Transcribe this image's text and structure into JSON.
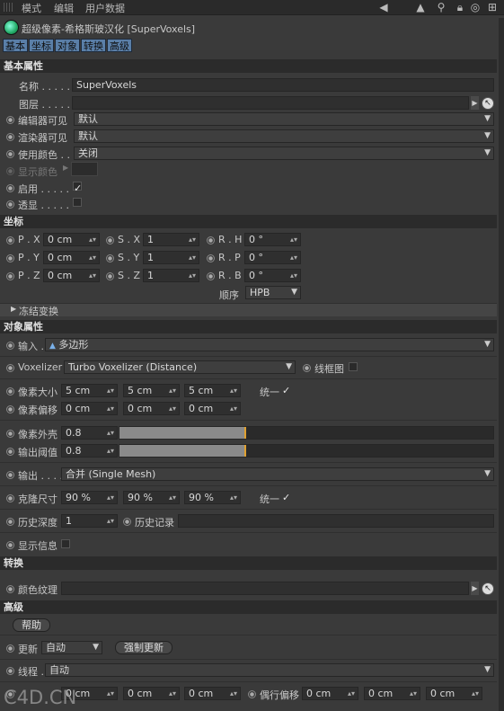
{
  "menubar": {
    "items": [
      "模式",
      "编辑",
      "用户数据"
    ]
  },
  "object": {
    "title": "超级像素-希格斯玻汉化 [SuperVoxels]"
  },
  "tabs": [
    "基本",
    "坐标",
    "对象",
    "转换",
    "高级"
  ],
  "basic": {
    "heading": "基本属性",
    "name_label": "名称 . . . . .",
    "name_value": "SuperVoxels",
    "layer_label": "图层 . . . . .",
    "editor_visible_label": "编辑器可见",
    "editor_visible_value": "默认",
    "render_visible_label": "渲染器可见",
    "render_visible_value": "默认",
    "use_color_label": "使用颜色 . .",
    "use_color_value": "关闭",
    "display_color_label": "显示颜色",
    "enable_label": "启用 . . . . .",
    "enable_checked": true,
    "xray_label": "透显 . . . . .",
    "xray_checked": false
  },
  "coord": {
    "heading": "坐标",
    "rows": [
      {
        "p_label": "P . X",
        "p_value": "0 cm",
        "s_label": "S . X",
        "s_value": "1",
        "r_label": "R . H",
        "r_value": "0 °"
      },
      {
        "p_label": "P . Y",
        "p_value": "0 cm",
        "s_label": "S . Y",
        "s_value": "1",
        "r_label": "R . P",
        "r_value": "0 °"
      },
      {
        "p_label": "P . Z",
        "p_value": "0 cm",
        "s_label": "S . Z",
        "s_value": "1",
        "r_label": "R . B",
        "r_value": "0 °"
      }
    ],
    "order_label": "顺序",
    "order_value": "HPB",
    "freeze_label": "冻结变换"
  },
  "objprops": {
    "heading": "对象属性",
    "input_label": "输入 . . . . .",
    "input_value": "多边形",
    "voxelizer_label": "Voxelizer",
    "voxelizer_value": "Turbo Voxelizer (Distance)",
    "wireframe_label": "线框图",
    "voxel_size_label": "像素大小",
    "voxel_size_values": [
      "5 cm",
      "5 cm",
      "5 cm"
    ],
    "uniform_label": "统一",
    "voxel_offset_label": "像素偏移",
    "voxel_offset_values": [
      "0 cm",
      "0 cm",
      "0 cm"
    ],
    "shell_label": "像素外壳",
    "shell_value": "0.8",
    "shell_fraction": 0.8,
    "threshold_label": "输出阈值",
    "threshold_value": "0.8",
    "threshold_fraction": 0.8,
    "output_label": "输出 . . . . .",
    "output_value": "合并 (Single Mesh)",
    "clone_size_label": "克隆尺寸",
    "clone_size_values": [
      "90 %",
      "90 %",
      "90 %"
    ],
    "clone_uniform_label": "统一",
    "history_depth_label": "历史深度",
    "history_depth_value": "1",
    "history_record_label": "历史记录",
    "show_info_label": "显示信息"
  },
  "convert": {
    "heading": "转换",
    "color_texture_label": "颜色纹理"
  },
  "advanced": {
    "heading": "高级",
    "help_label": "帮助",
    "update_label": "更新 . . . . .",
    "update_value": "自动",
    "force_update_label": "强制更新",
    "thread_label": "线程 . . . . .",
    "thread_value": "自动",
    "offset_values": [
      "0 cm",
      "0 cm",
      "0 cm"
    ],
    "odd_offset_label": "偶行偏移",
    "odd_offset_values": [
      "0 cm",
      "0 cm",
      "0 cm"
    ]
  },
  "watermark": "C4D.CN"
}
